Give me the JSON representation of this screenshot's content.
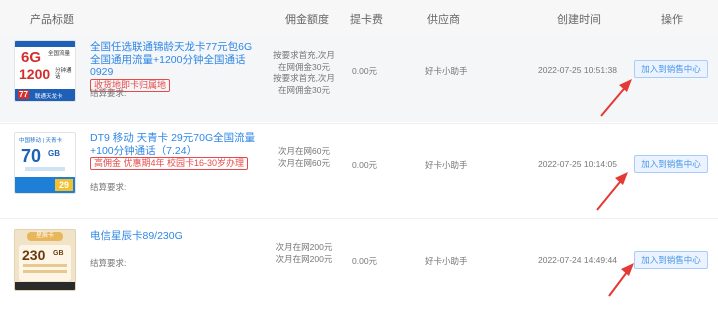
{
  "header": {
    "product_title": "产品标题",
    "commission": "佣金额度",
    "withdraw_fee": "提卡费",
    "supplier": "供应商",
    "created_time": "创建时间",
    "action": "操作"
  },
  "rows": [
    {
      "title": "全国任选联通锦龄天龙卡77元包6G全国通用流量+1200分钟全国通话0929",
      "tag": "收货地即卡归属地",
      "settle_label": "结算要求:",
      "commission_lines": [
        "按要求首充,次月",
        "在网佣金30元",
        "按要求首充,次月",
        "在网佣金30元"
      ],
      "fee": "0.00元",
      "supplier": "好卡小助手",
      "time": "2022-07-25 10:51:38",
      "button": "加入到销售中心",
      "thumb": {
        "line1": "6G",
        "line1b": "全国流量",
        "line2": "1200",
        "line2b": "分钟通话",
        "price": "77",
        "foot": "联通天龙卡"
      }
    },
    {
      "title": "DT9 移动 天青卡 29元70G全国流量+100分钟通话（7.24）",
      "tag": "高佣金 优惠期4年 校园卡16-30岁办理",
      "settle_label": "结算要求:",
      "commission_lines": [
        "次月在网60元",
        "次月在网60元"
      ],
      "fee": "0.00元",
      "supplier": "好卡小助手",
      "time": "2022-07-25 10:14:05",
      "button": "加入到销售中心",
      "thumb": {
        "brand": "中国移动 | 天青卡",
        "big": "70",
        "unit": "GB",
        "price": "29"
      }
    },
    {
      "title": "电信星辰卡89/230G",
      "tag": "",
      "settle_label": "结算要求:",
      "commission_lines": [
        "次月在网200元",
        "次月在网200元"
      ],
      "fee": "0.00元",
      "supplier": "好卡小助手",
      "time": "2022-07-24 14:49:44",
      "button": "加入到销售中心",
      "thumb": {
        "label": "星辰卡",
        "big": "230",
        "unit": "GB"
      }
    }
  ]
}
